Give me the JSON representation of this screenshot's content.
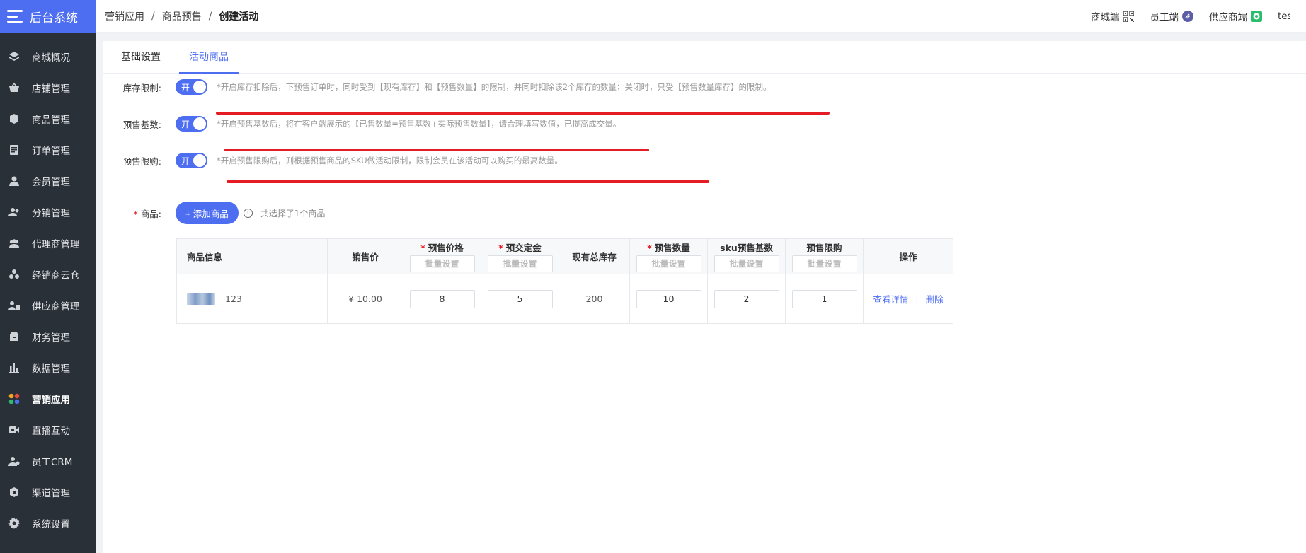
{
  "app": {
    "title": "后台系统"
  },
  "sidebar": {
    "items": [
      {
        "label": "商城概况",
        "icon": "layers-icon"
      },
      {
        "label": "店铺管理",
        "icon": "basket-icon"
      },
      {
        "label": "商品管理",
        "icon": "cube-icon"
      },
      {
        "label": "订单管理",
        "icon": "document-icon"
      },
      {
        "label": "会员管理",
        "icon": "user-icon"
      },
      {
        "label": "分销管理",
        "icon": "distribution-icon"
      },
      {
        "label": "代理商管理",
        "icon": "agents-icon"
      },
      {
        "label": "经销商云仓",
        "icon": "cloud-warehouse-icon"
      },
      {
        "label": "供应商管理",
        "icon": "supplier-icon"
      },
      {
        "label": "财务管理",
        "icon": "finance-icon"
      },
      {
        "label": "数据管理",
        "icon": "bar-chart-icon"
      },
      {
        "label": "营销应用",
        "icon": "apps-icon",
        "active": true
      },
      {
        "label": "直播互动",
        "icon": "live-video-icon"
      },
      {
        "label": "员工CRM",
        "icon": "staff-icon"
      },
      {
        "label": "渠道管理",
        "icon": "channel-icon"
      },
      {
        "label": "系统设置",
        "icon": "gear-icon"
      }
    ]
  },
  "breadcrumb": {
    "level1": "营销应用",
    "level2": "商品预售",
    "current": "创建活动",
    "sep": "/"
  },
  "topbar": {
    "mall": "商城端",
    "staff": "员工端",
    "supplier": "供应商端",
    "user": "test"
  },
  "tabs": [
    {
      "label": "基础设置",
      "active": false
    },
    {
      "label": "活动商品",
      "active": true
    }
  ],
  "settings": {
    "stock_limit": {
      "label": "库存限制:",
      "switch": "开",
      "tip": "*开启库存扣除后，下预售订单时，同时受到【现有库存】和【预售数量】的限制，并同时扣除该2个库存的数量；关闭时，只受【预售数量库存】的限制。"
    },
    "base_count": {
      "label": "预售基数:",
      "switch": "开",
      "tip": "*开启预售基数后，将在客户端展示的【已售数量=预售基数+实际预售数量】，请合理填写数值，已提高成交量。"
    },
    "purchase_limit": {
      "label": "预售限购:",
      "switch": "开",
      "tip": "*开启预售限购后，则根据预售商品的SKU做活动限制，限制会员在该活动可以购买的最高数量。"
    },
    "goods": {
      "label": "商品:",
      "required": "*",
      "add_button": "+ 添加商品",
      "selected_text": "共选择了1个商品",
      "info_icon": "i"
    }
  },
  "table": {
    "headers": {
      "info": "商品信息",
      "price": "销售价",
      "presale_price": "预售价格",
      "deposit": "预交定金",
      "stock": "现有总库存",
      "presale_qty": "预售数量",
      "sku_base": "sku预售基数",
      "limit": "预售限购",
      "ops": "操作"
    },
    "required_mark": "*",
    "batch_placeholder": "批量设置",
    "rows": [
      {
        "name": "123",
        "price": "¥ 10.00",
        "presale_price": "8",
        "deposit": "5",
        "stock": "200",
        "presale_qty": "10",
        "sku_base": "2",
        "limit": "1",
        "view": "查看详情",
        "sep": "|",
        "delete": "删除"
      }
    ]
  },
  "colors": {
    "primary": "#4e6ef2",
    "sidebar": "#2a3038",
    "annotation": "#e51c23"
  }
}
